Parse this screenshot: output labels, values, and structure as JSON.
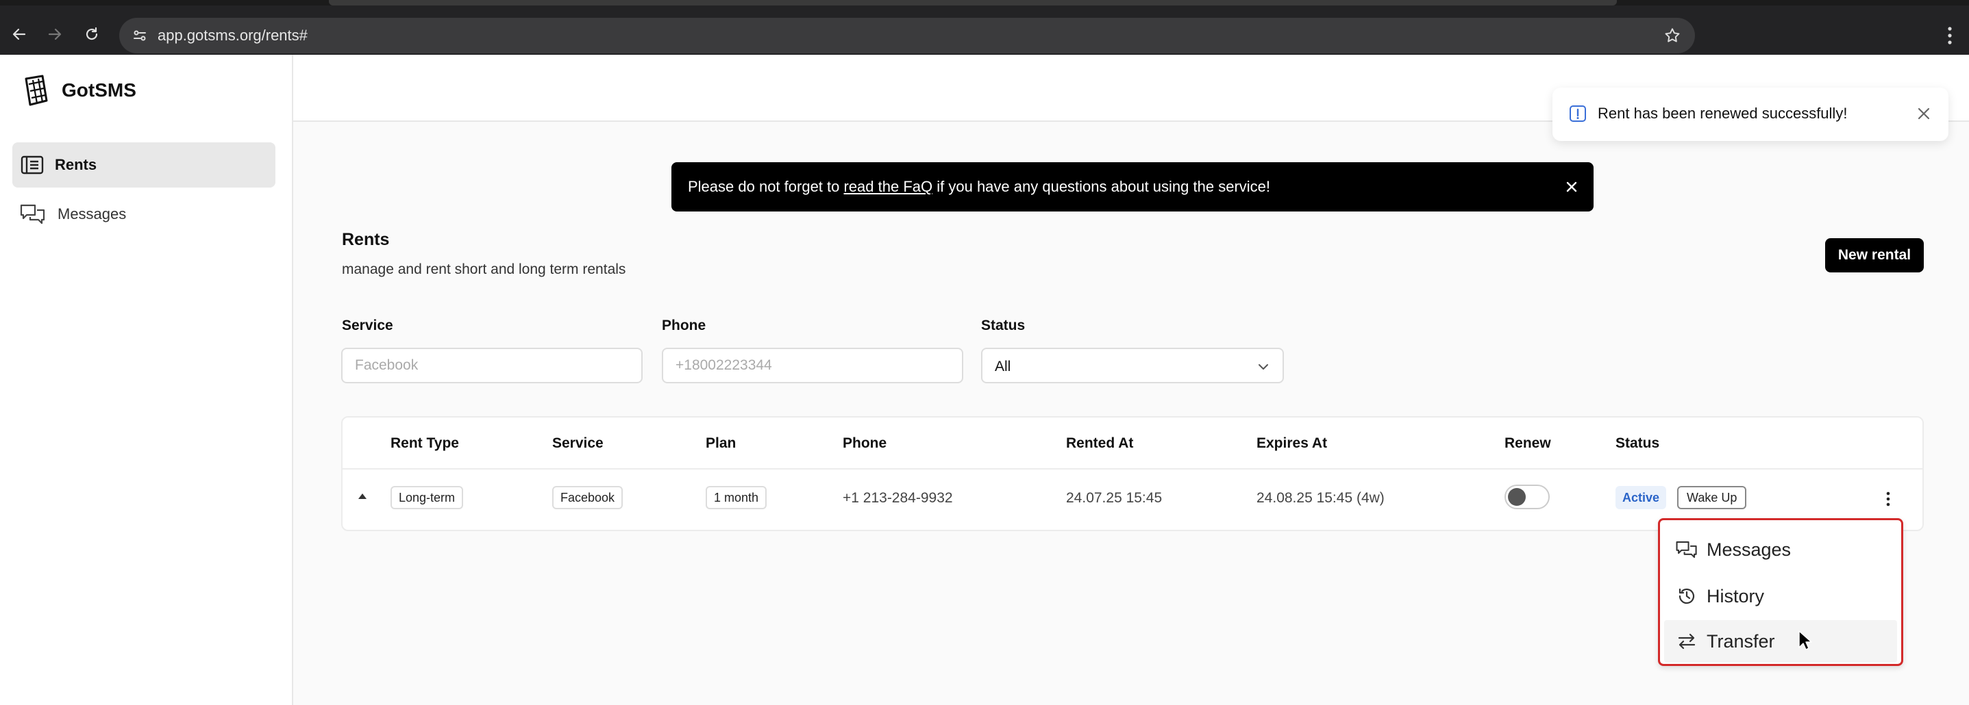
{
  "browser": {
    "url": "app.gotsms.org/rents#"
  },
  "app": {
    "brand": "GotSMS"
  },
  "sidebar": {
    "items": [
      {
        "label": "Rents",
        "icon": "rents-icon",
        "active": true
      },
      {
        "label": "Messages",
        "icon": "messages-icon",
        "active": false
      }
    ]
  },
  "toast": {
    "message": "Rent has been renewed successfully!"
  },
  "banner": {
    "text_before": "Please do not forget to ",
    "link": "read the FaQ",
    "text_after": " if you have any questions about using the service!"
  },
  "page": {
    "title": "Rents",
    "subtitle": "manage and rent short and long term rentals",
    "new_button": "New rental"
  },
  "filters": {
    "service": {
      "label": "Service",
      "placeholder": "Facebook",
      "value": ""
    },
    "phone": {
      "label": "Phone",
      "placeholder": "+18002223344",
      "value": ""
    },
    "status": {
      "label": "Status",
      "value": "All"
    }
  },
  "table": {
    "columns": [
      "Rent Type",
      "Service",
      "Plan",
      "Phone",
      "Rented At",
      "Expires At",
      "Renew",
      "Status"
    ],
    "rows": [
      {
        "rent_type": "Long-term",
        "service": "Facebook",
        "plan": "1 month",
        "phone": "+1 213-284-9932",
        "rented_at": "24.07.25 15:45",
        "expires_at": "24.08.25 15:45 (4w)",
        "renew": false,
        "status": "Active",
        "action": "Wake Up"
      }
    ]
  },
  "row_menu": {
    "items": [
      {
        "label": "Messages",
        "icon": "messages-icon"
      },
      {
        "label": "History",
        "icon": "history-icon"
      },
      {
        "label": "Transfer",
        "icon": "transfer-icon"
      }
    ]
  },
  "colors": {
    "accent_black": "#000000",
    "active_badge_bg": "#eaf1fb",
    "active_badge_text": "#2a64c8",
    "highlight_border": "#d32a2a"
  }
}
